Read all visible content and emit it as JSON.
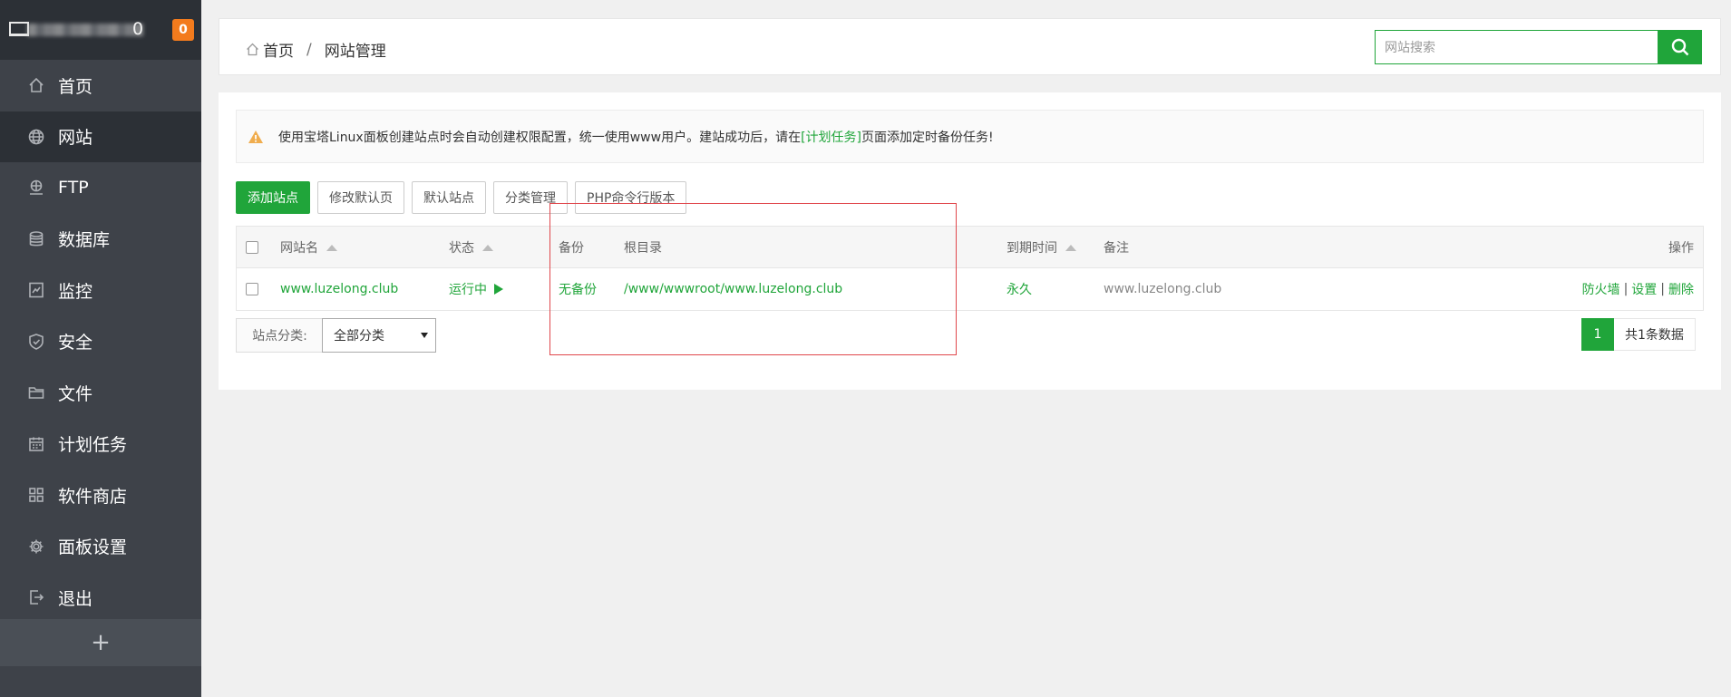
{
  "sidebar": {
    "brand_suffix": "0",
    "badge": "0",
    "items": [
      {
        "label": "首页",
        "icon": "home-icon"
      },
      {
        "label": "网站",
        "icon": "globe-icon"
      },
      {
        "label": "FTP",
        "icon": "ftp-icon"
      },
      {
        "label": "数据库",
        "icon": "database-icon"
      },
      {
        "label": "监控",
        "icon": "monitor-icon"
      },
      {
        "label": "安全",
        "icon": "shield-icon"
      },
      {
        "label": "文件",
        "icon": "folder-icon"
      },
      {
        "label": "计划任务",
        "icon": "calendar-icon"
      },
      {
        "label": "软件商店",
        "icon": "apps-icon"
      },
      {
        "label": "面板设置",
        "icon": "gear-icon"
      },
      {
        "label": "退出",
        "icon": "logout-icon"
      }
    ],
    "add_label": "+"
  },
  "header": {
    "breadcrumb_home": "首页",
    "breadcrumb_sep": "/",
    "breadcrumb_current": "网站管理",
    "search_placeholder": "网站搜索"
  },
  "alert": {
    "text_before": "使用宝塔Linux面板创建站点时会自动创建权限配置，统一使用www用户。建站成功后，请在",
    "link": "[计划任务]",
    "text_after": "页面添加定时备份任务!"
  },
  "toolbar": {
    "add_site": "添加站点",
    "edit_default_page": "修改默认页",
    "default_site": "默认站点",
    "category_manage": "分类管理",
    "php_cli_version": "PHP命令行版本"
  },
  "table": {
    "headers": {
      "name": "网站名",
      "status": "状态",
      "backup": "备份",
      "root": "根目录",
      "expire": "到期时间",
      "note": "备注",
      "actions": "操作"
    },
    "rows": [
      {
        "name": "www.luzelong.club",
        "status": "运行中",
        "backup": "无备份",
        "root": "/www/wwwroot/www.luzelong.club",
        "expire": "永久",
        "note": "www.luzelong.club",
        "actions": [
          "防火墙",
          "设置",
          "删除"
        ]
      }
    ]
  },
  "category": {
    "label": "站点分类:",
    "selected": "全部分类"
  },
  "pager": {
    "current": "1",
    "total": "共1条数据"
  },
  "colors": {
    "accent": "#20a53a",
    "sidebar": "#3e4249",
    "badge": "#f37b1d",
    "highlight": "#e0474c"
  }
}
